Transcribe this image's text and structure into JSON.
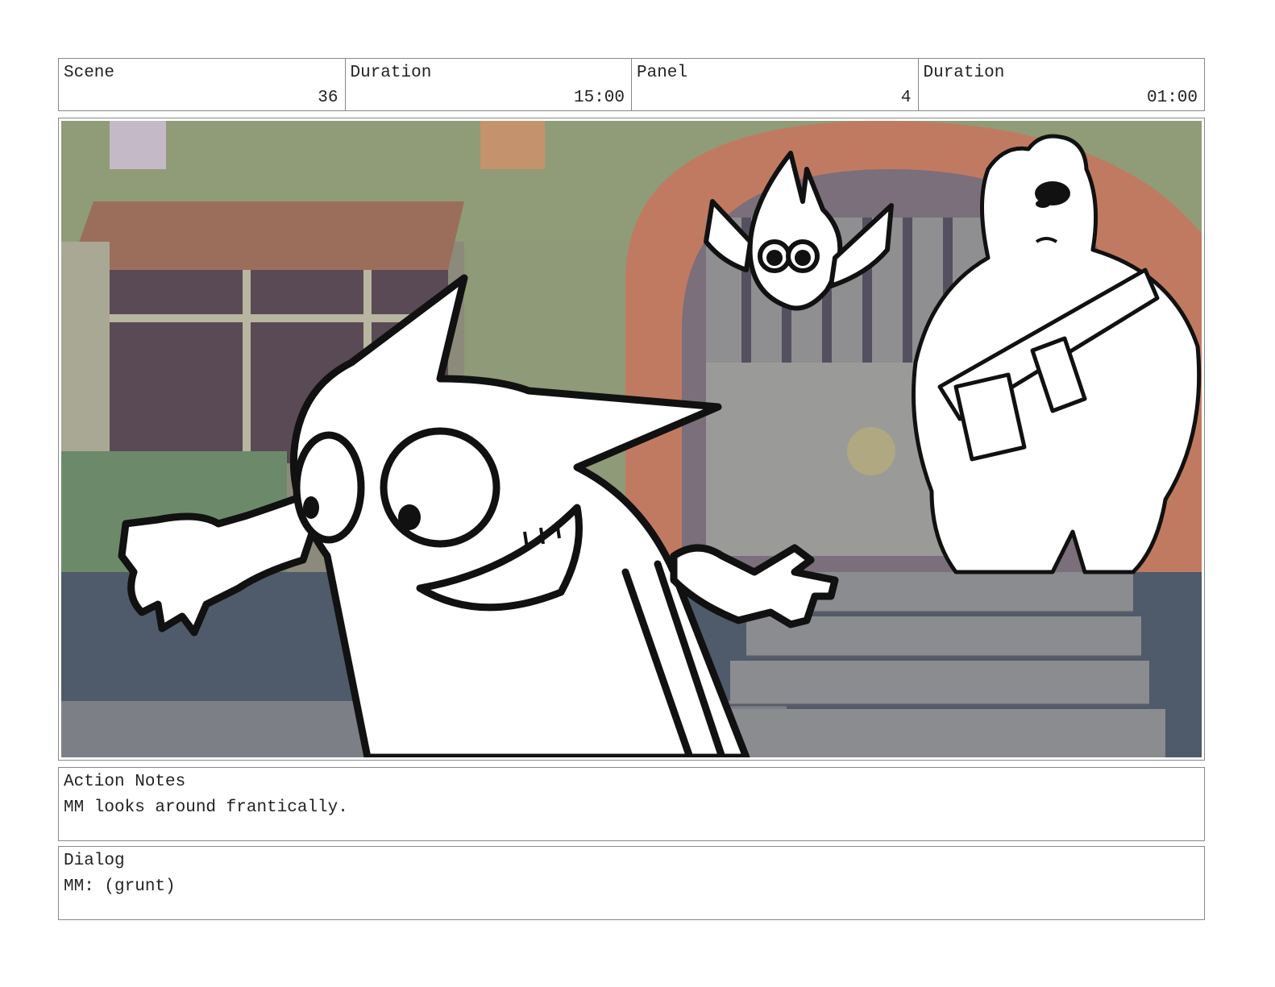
{
  "header": {
    "scene_label": "Scene",
    "scene_value": "36",
    "duration_label": "Duration",
    "duration_value": "15:00",
    "panel_label": "Panel",
    "panel_value": "4",
    "panel_duration_label": "Duration",
    "panel_duration_value": "01:00"
  },
  "frame": {
    "image": "storyboard-panel-sketch"
  },
  "action": {
    "label": "Action Notes",
    "text": "MM looks around frantically."
  },
  "dialog": {
    "label": "Dialog",
    "text": "MM: (grunt)"
  }
}
